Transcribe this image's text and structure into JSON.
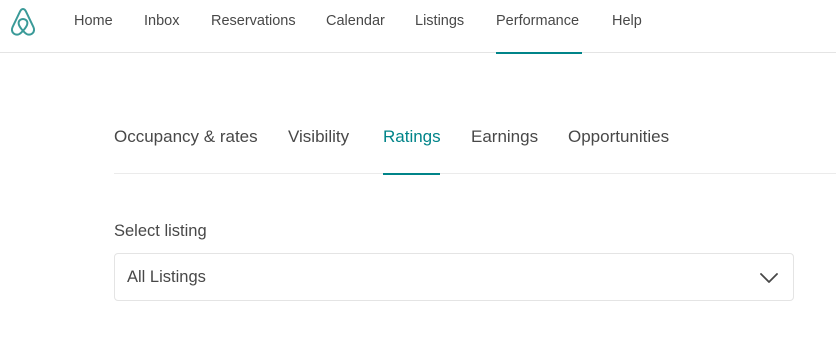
{
  "brand": {
    "logo_icon": "airbnb-logo-icon",
    "accent_color": "#008489",
    "logo_color": "#3a9a98"
  },
  "topnav": {
    "items": [
      {
        "label": "Home"
      },
      {
        "label": "Inbox"
      },
      {
        "label": "Reservations"
      },
      {
        "label": "Calendar"
      },
      {
        "label": "Listings"
      },
      {
        "label": "Performance",
        "active": true
      },
      {
        "label": "Help"
      }
    ]
  },
  "tabs": {
    "items": [
      {
        "label": "Occupancy & rates"
      },
      {
        "label": "Visibility"
      },
      {
        "label": "Ratings",
        "active": true
      },
      {
        "label": "Earnings"
      },
      {
        "label": "Opportunities"
      }
    ]
  },
  "listing_select": {
    "label": "Select listing",
    "value": "All Listings",
    "icon": "chevron-down-icon"
  }
}
